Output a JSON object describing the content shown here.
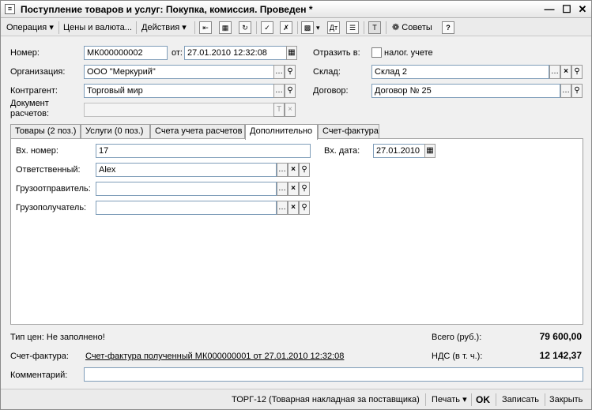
{
  "window": {
    "title": "Поступление товаров и услуг: Покупка, комиссия. Проведен *"
  },
  "toolbar": {
    "operation": "Операция",
    "prices": "Цены и валюта...",
    "actions": "Действия",
    "tips": "Советы",
    "help": "?"
  },
  "header": {
    "number_label": "Номер:",
    "number_value": "МК000000002",
    "date_label": "от:",
    "date_value": "27.01.2010 12:32:08",
    "reflect_label": "Отразить в:",
    "tax_label": "налог. учете",
    "org_label": "Организация:",
    "org_value": "ООО \"Меркурий\"",
    "warehouse_label": "Склад:",
    "warehouse_value": "Склад 2",
    "contractor_label": "Контрагент:",
    "contractor_value": "Торговый мир",
    "contract_label": "Договор:",
    "contract_value": "Договор № 25",
    "settle_doc_label_1": "Документ",
    "settle_doc_label_2": "расчетов:",
    "settle_doc_value": ""
  },
  "tabs": [
    {
      "label": "Товары (2 поз.)"
    },
    {
      "label": "Услуги (0 поз.)"
    },
    {
      "label": "Счета учета расчетов"
    },
    {
      "label": "Дополнительно"
    },
    {
      "label": "Счет-фактура"
    }
  ],
  "extra": {
    "in_number_label": "Вх. номер:",
    "in_number_value": "17",
    "in_date_label": "Вх. дата:",
    "in_date_value": "27.01.2010",
    "responsible_label": "Ответственный:",
    "responsible_value": "Alex",
    "shipper_label": "Грузоотправитель:",
    "shipper_value": "",
    "consignee_label": "Грузополучатель:",
    "consignee_value": ""
  },
  "footer": {
    "price_type": "Тип цен: Не заполнено!",
    "total_label": "Всего (руб.):",
    "total_value": "79 600,00",
    "invoice_label": "Счет-фактура:",
    "invoice_link": "Счет-фактура полученный МК000000001 от 27.01.2010 12:32:08",
    "vat_label": "НДС (в т. ч.):",
    "vat_value": "12 142,37",
    "comment_label": "Комментарий:",
    "comment_value": ""
  },
  "bottombar": {
    "torg": "ТОРГ-12 (Товарная накладная за поставщика)",
    "print": "Печать",
    "ok": "OK",
    "save": "Записать",
    "close": "Закрыть"
  },
  "icons": [
    "document-icon",
    "minimize-icon",
    "maximize-icon",
    "close-icon",
    "calendar-icon",
    "select-icon",
    "clear-icon",
    "search-icon",
    "lightbulb-icon",
    "help-icon"
  ]
}
